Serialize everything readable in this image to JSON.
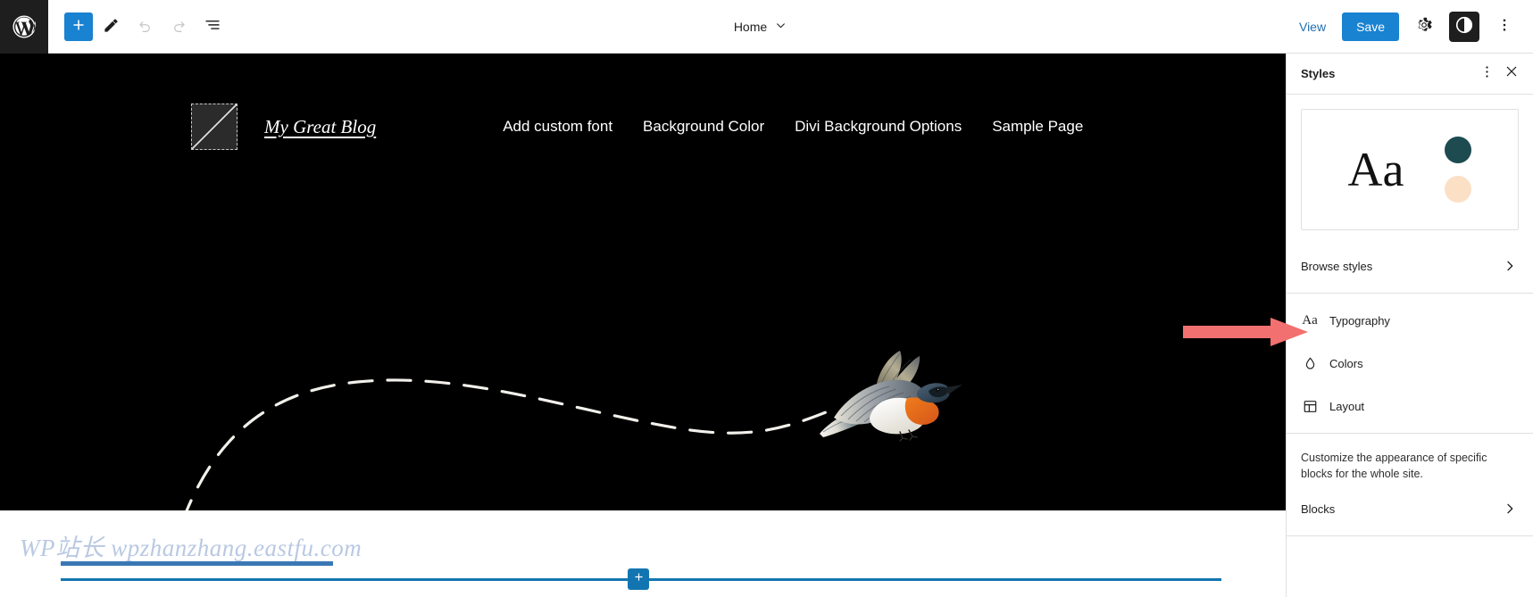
{
  "colors": {
    "accent_blue": "#1982d1",
    "link_blue": "#2271b1",
    "inserter_blue": "#1275b1",
    "canvas_black": "#000000",
    "toolbar_dark": "#1e1e1e",
    "arrow_red": "#f2706f",
    "swatch_dark_teal": "#1d4b50",
    "swatch_peach": "#fbe0c6",
    "watermark_blue": "#b9c9e2",
    "watermark_rule_blue": "#3a78b5",
    "panel_border": "#e0e0e0"
  },
  "toolbar": {
    "wp_logo_icon": "wordpress-logo-icon",
    "add_block_label": "+",
    "add_block_icon": "plus-icon",
    "edit_tool_icon": "pencil-icon",
    "undo_icon": "undo-arrow-icon",
    "redo_icon": "redo-arrow-icon",
    "list_view_icon": "list-view-icon",
    "document_title": "Home",
    "document_chevron_icon": "chevron-down-icon",
    "view_label": "View",
    "save_label": "Save",
    "settings_icon": "gear-icon",
    "styles_icon": "styles-contrast-icon",
    "more_options_icon": "three-dots-vertical-icon"
  },
  "canvas": {
    "site_title": "My Great Blog",
    "logo_placeholder_icon": "image-placeholder-icon",
    "nav_items": [
      {
        "label": "Add custom font"
      },
      {
        "label": "Background Color"
      },
      {
        "label": "Divi Background Options"
      },
      {
        "label": "Sample Page"
      }
    ],
    "bird_image_alt": "flying-bird-illustration",
    "dashed_path_alt": "dashed-flight-path"
  },
  "bottom": {
    "watermark_text": "WP站长  wpzhanzhang.eastfu.com",
    "inserter_plus_label": "+",
    "inserter_plus_icon": "plus-icon"
  },
  "sidebar": {
    "header": {
      "title": "Styles",
      "more_icon": "three-dots-vertical-icon",
      "close_icon": "close-x-icon"
    },
    "preview": {
      "type_sample": "Aa",
      "swatches": [
        "#1d4b50",
        "#fbe0c6"
      ]
    },
    "browse": {
      "label": "Browse styles",
      "chevron_icon": "chevron-right-icon"
    },
    "items": [
      {
        "label": "Typography",
        "icon": "aa-typography-icon"
      },
      {
        "label": "Colors",
        "icon": "droplet-icon"
      },
      {
        "label": "Layout",
        "icon": "layout-grid-icon"
      }
    ],
    "blocks_description": "Customize the appearance of specific blocks for the whole site.",
    "blocks": {
      "label": "Blocks",
      "chevron_icon": "chevron-right-icon"
    }
  },
  "annotation": {
    "arrow_icon": "red-arrow-right-icon",
    "points_to": "Typography"
  }
}
